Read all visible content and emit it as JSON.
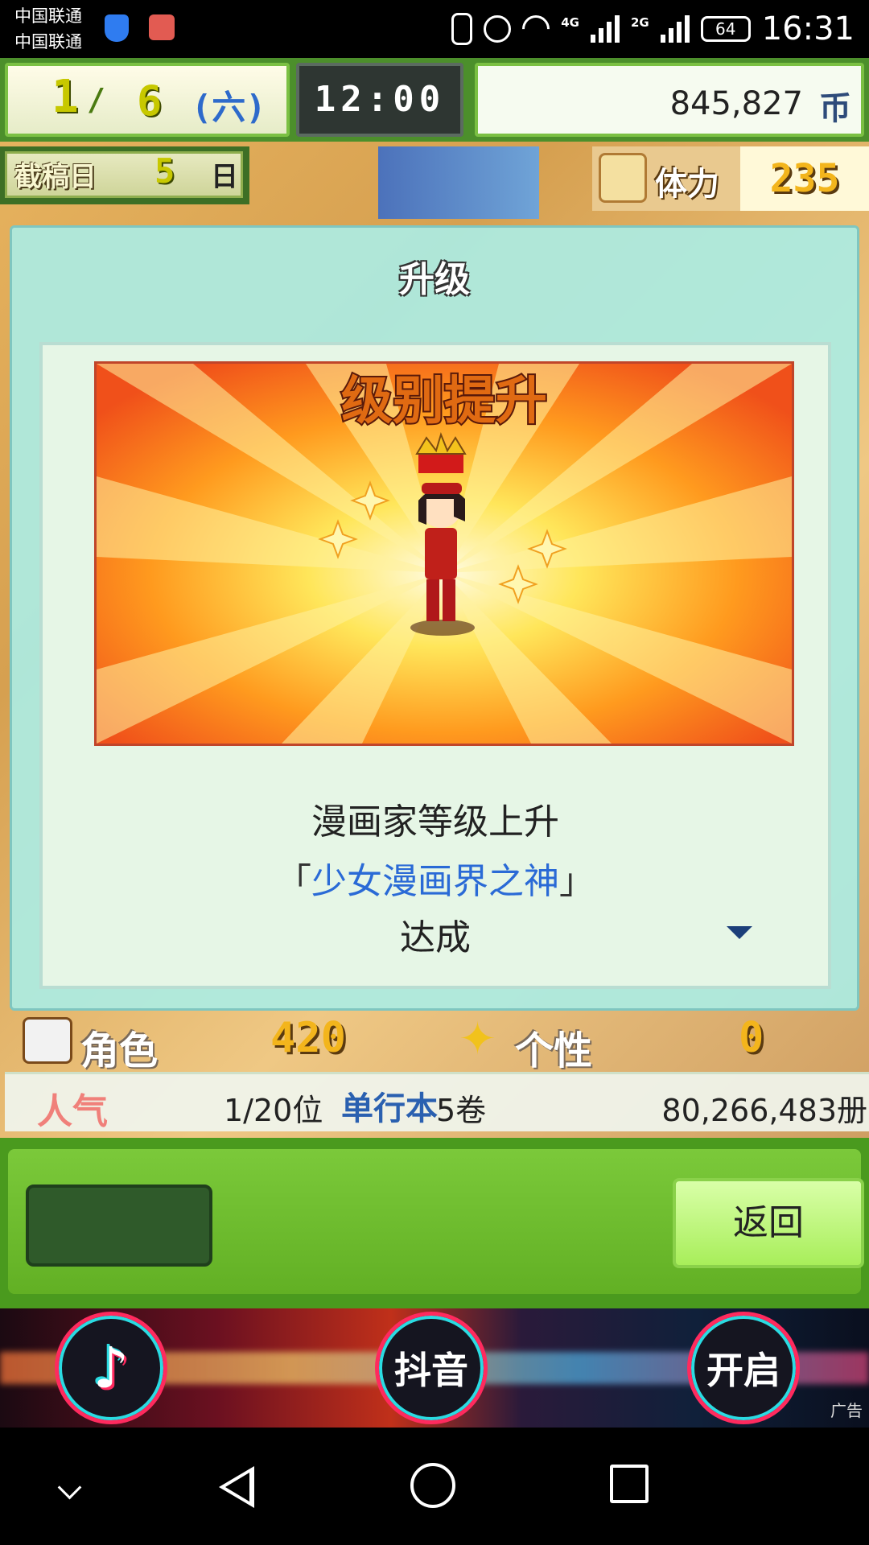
{
  "status_bar": {
    "carrier1": "中国联通",
    "carrier2": "中国联通",
    "net1": "4G",
    "net2": "2G",
    "battery": "64",
    "time": "16:31"
  },
  "hud": {
    "month": "1",
    "day": "6",
    "weekday": "(六)",
    "clock": "12:00",
    "money": "845,827",
    "money_unit": "币",
    "deadline_label": "截稿日",
    "deadline_value": "5",
    "deadline_unit": "日",
    "stamina_label": "体力",
    "stamina_value": "235"
  },
  "dialog": {
    "title": "升级",
    "banner_title": "级别提升",
    "message_line1": "漫画家等级上升",
    "bracket_open": "「",
    "rank_title": "少女漫画界之神",
    "bracket_close": "」",
    "message_line3": "达成"
  },
  "stats": {
    "role_label": "角色",
    "role_value": "420",
    "personality_label": "个性",
    "personality_value": "0",
    "popularity_label": "人气",
    "popularity_rank": "1/20位",
    "books_label": "单行本",
    "books_value": "5卷",
    "total_sales": "80,266,483册"
  },
  "commands": {
    "back_label": "返回"
  },
  "ad": {
    "btn1_icon": "tiktok-icon",
    "btn2_label": "抖音",
    "btn3_label": "开启",
    "note": "广告"
  },
  "colors": {
    "accent_green": "#62b024",
    "dialog_teal": "#acece2",
    "rank_title_blue": "#2a6ad6",
    "gold_number": "#f3b51c"
  }
}
